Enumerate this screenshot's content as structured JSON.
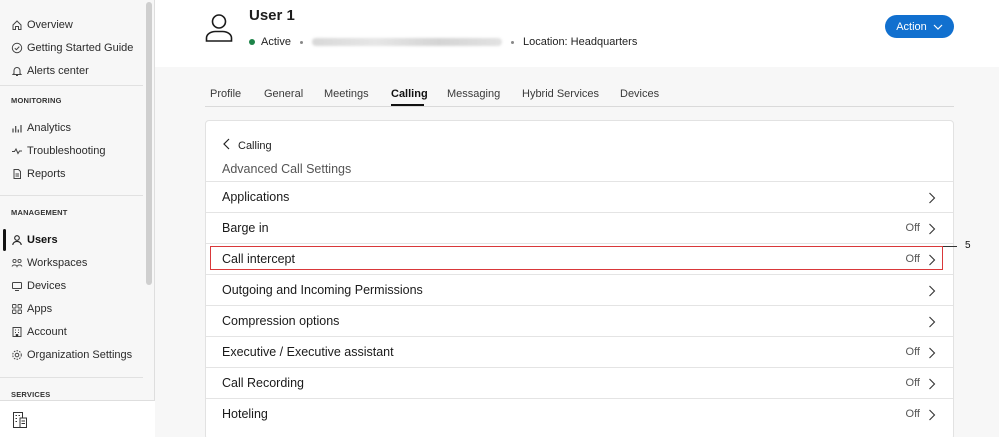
{
  "sidebar": {
    "items": [
      {
        "label": "Overview",
        "icon": "home-icon"
      },
      {
        "label": "Getting Started Guide",
        "icon": "check-circle-icon"
      },
      {
        "label": "Alerts center",
        "icon": "bell-icon"
      }
    ],
    "section_monitoring": "MONITORING",
    "monitoring_items": [
      {
        "label": "Analytics",
        "icon": "bar-chart-icon"
      },
      {
        "label": "Troubleshooting",
        "icon": "pulse-icon"
      },
      {
        "label": "Reports",
        "icon": "document-icon"
      }
    ],
    "section_management": "MANAGEMENT",
    "management_items": [
      {
        "label": "Users",
        "icon": "user-icon",
        "active": true
      },
      {
        "label": "Workspaces",
        "icon": "workspaces-icon"
      },
      {
        "label": "Devices",
        "icon": "devices-icon"
      },
      {
        "label": "Apps",
        "icon": "apps-grid-icon"
      },
      {
        "label": "Account",
        "icon": "building-icon"
      },
      {
        "label": "Organization Settings",
        "icon": "gear-icon"
      }
    ],
    "section_services": "SERVICES"
  },
  "header": {
    "user_name": "User 1",
    "status": "Active",
    "location": "Location: Headquarters",
    "action_label": "Action"
  },
  "tabs": [
    "Profile",
    "General",
    "Meetings",
    "Calling",
    "Messaging",
    "Hybrid Services",
    "Devices"
  ],
  "active_tab": "Calling",
  "card": {
    "back_label": "Calling",
    "title": "Advanced Call Settings",
    "rows": [
      {
        "label": "Applications",
        "value": ""
      },
      {
        "label": "Barge in",
        "value": "Off"
      },
      {
        "label": "Call intercept",
        "value": "Off"
      },
      {
        "label": "Outgoing and Incoming Permissions",
        "value": ""
      },
      {
        "label": "Compression options",
        "value": ""
      },
      {
        "label": "Executive / Executive assistant",
        "value": "Off"
      },
      {
        "label": "Call Recording",
        "value": "Off"
      },
      {
        "label": "Hoteling",
        "value": "Off"
      }
    ]
  },
  "callout": {
    "number": "5",
    "color": "#d9383a"
  },
  "colors": {
    "accent": "#1170cf",
    "status_active": "#1d8348"
  }
}
